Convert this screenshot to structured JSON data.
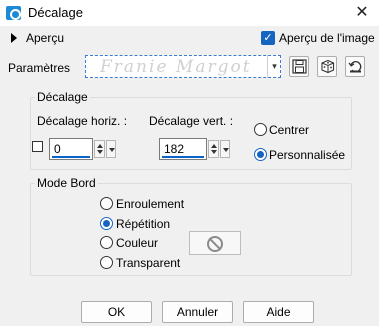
{
  "window": {
    "title": "Décalage",
    "close_glyph": "✕",
    "icon": "app-icon"
  },
  "preview": {
    "toggle_label": "Aperçu",
    "on_image_label": "Aperçu de l'image",
    "on_image_checked": true
  },
  "params": {
    "label": "Paramètres",
    "preset_value": "Franie Margot",
    "preset_arrow": "▾",
    "tools": [
      "save-preset-icon",
      "randomize-dice-icon",
      "reset-icon"
    ]
  },
  "offset": {
    "group_title": "Décalage",
    "horiz_label": "Décalage horiz. :",
    "horiz_value": "0",
    "vert_label": "Décalage vert. :",
    "vert_value": "182",
    "link_checked": false,
    "center_label": "Centrer",
    "custom_label": "Personnalisée",
    "selected": "custom"
  },
  "edge": {
    "group_title": "Mode Bord",
    "wrap_label": "Enroulement",
    "repeat_label": "Répétition",
    "color_label": "Couleur",
    "transparent_label": "Transparent",
    "selected": "repeat",
    "color_swatch_icon": "no-color-icon"
  },
  "buttons": {
    "ok": "OK",
    "cancel": "Annuler",
    "help": "Aide"
  },
  "colors": {
    "accent": "#1565c0",
    "app_icon": "#1c8ad6",
    "background": "#f0f0f0"
  }
}
